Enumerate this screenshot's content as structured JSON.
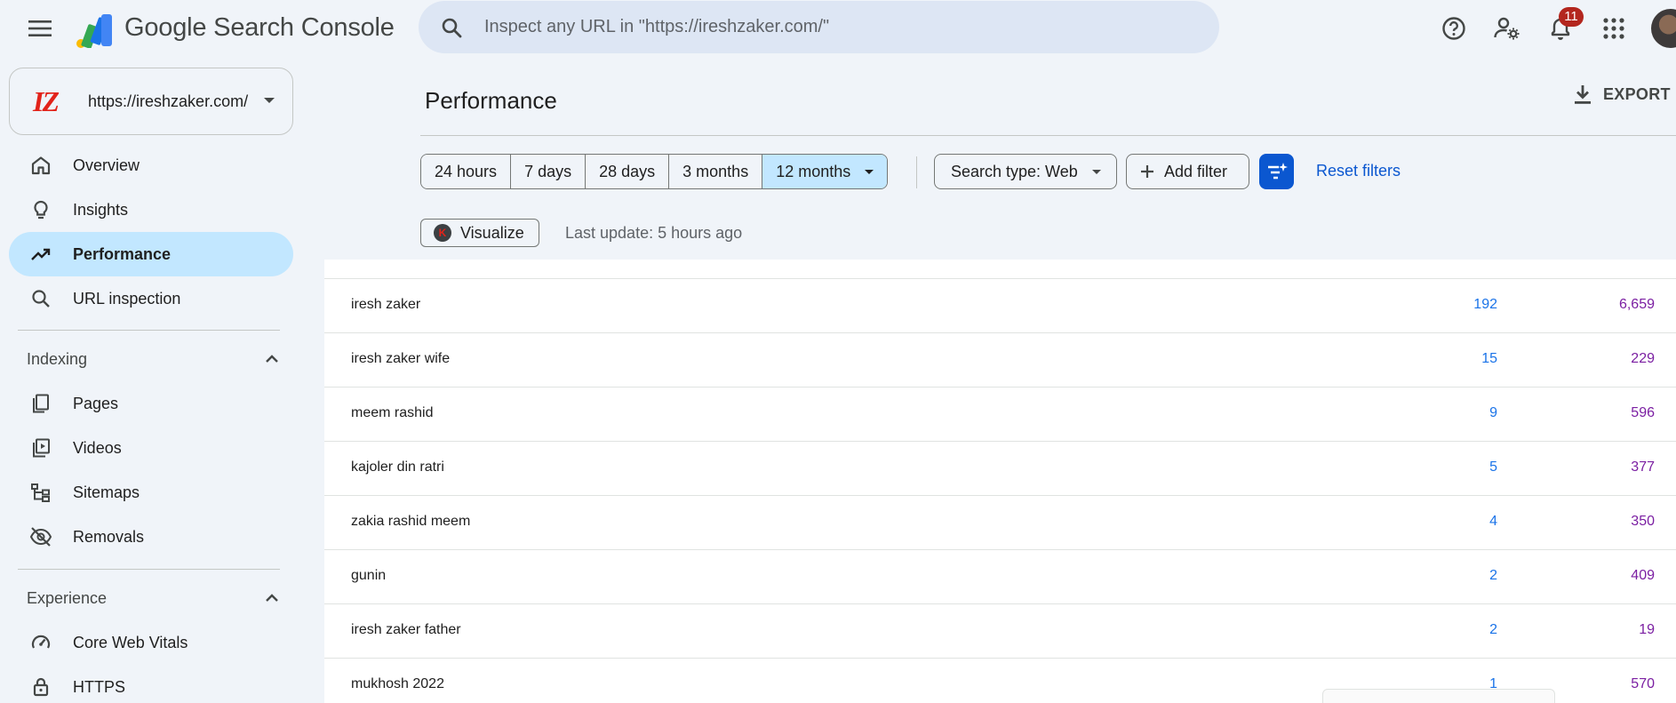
{
  "app": {
    "brand": "Google Search Console"
  },
  "search": {
    "placeholder": "Inspect any URL in \"https://ireshzaker.com/\""
  },
  "header": {
    "notification_count": "11"
  },
  "property": {
    "logo_text": "IZ",
    "url": "https://ireshzaker.com/"
  },
  "sidebar": {
    "items": [
      {
        "label": "Overview",
        "icon": "home-icon"
      },
      {
        "label": "Insights",
        "icon": "lightbulb-icon"
      },
      {
        "label": "Performance",
        "icon": "trending-up-icon",
        "active": true
      },
      {
        "label": "URL inspection",
        "icon": "search-icon"
      }
    ],
    "indexing": {
      "title": "Indexing",
      "items": [
        {
          "label": "Pages",
          "icon": "pages-icon"
        },
        {
          "label": "Videos",
          "icon": "video-icon"
        },
        {
          "label": "Sitemaps",
          "icon": "sitemap-icon"
        },
        {
          "label": "Removals",
          "icon": "eye-off-icon"
        }
      ]
    },
    "experience": {
      "title": "Experience",
      "items": [
        {
          "label": "Core Web Vitals",
          "icon": "speed-icon"
        },
        {
          "label": "HTTPS",
          "icon": "lock-icon"
        }
      ]
    }
  },
  "main": {
    "title": "Performance",
    "export_label": "EXPORT",
    "date_ranges": [
      "24 hours",
      "7 days",
      "28 days",
      "3 months",
      "12 months"
    ],
    "selected_range": "12 months",
    "search_type_label": "Search type: Web",
    "add_filter_label": "Add filter",
    "reset_filters_label": "Reset filters",
    "visualize_label": "Visualize",
    "visualize_icon_text": "K",
    "last_update": "Last update: 5 hours ago"
  },
  "table": {
    "rows": [
      {
        "query": "iresh zaker",
        "clicks": "192",
        "impressions": "6,659"
      },
      {
        "query": "iresh zaker wife",
        "clicks": "15",
        "impressions": "229"
      },
      {
        "query": "meem rashid",
        "clicks": "9",
        "impressions": "596"
      },
      {
        "query": "kajoler din ratri",
        "clicks": "5",
        "impressions": "377"
      },
      {
        "query": "zakia rashid meem",
        "clicks": "4",
        "impressions": "350"
      },
      {
        "query": "gunin",
        "clicks": "2",
        "impressions": "409"
      },
      {
        "query": "iresh zaker father",
        "clicks": "2",
        "impressions": "19"
      },
      {
        "query": "mukhosh 2022",
        "clicks": "1",
        "impressions": "570"
      }
    ]
  },
  "colors": {
    "background": "#f0f4f9",
    "active_nav": "#c2e7ff",
    "accent_blue": "#0b57d0",
    "clicks_color": "#1a73e8",
    "impressions_color": "#7b1fa2",
    "badge_red": "#b3261e"
  }
}
